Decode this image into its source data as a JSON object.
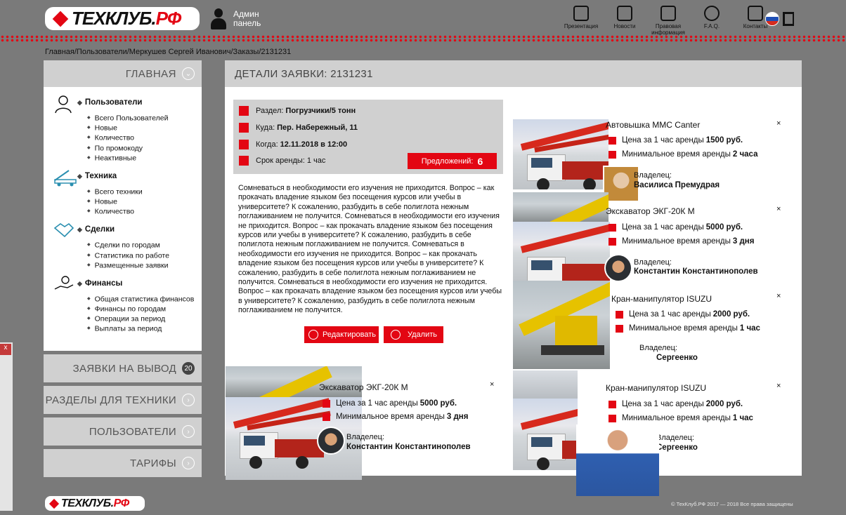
{
  "header": {
    "logo_main": "ТЕХКЛУБ.",
    "logo_suffix": "РФ",
    "admin_label": "Админ панель",
    "nav": [
      {
        "label": "Презентация",
        "icon": "presentation-icon"
      },
      {
        "label": "Новости",
        "icon": "news-icon"
      },
      {
        "label": "Правовая информация",
        "icon": "briefcase-icon"
      },
      {
        "label": "F.A.Q.",
        "icon": "faq-icon"
      },
      {
        "label": "Контакты",
        "icon": "contacts-icon"
      }
    ],
    "language_flag": "russian-flag-icon",
    "exit_icon": "logout-icon",
    "colors": {
      "accent": "#e30613",
      "bg": "#7a7a7a",
      "panel": "#d0d0d0"
    }
  },
  "breadcrumb": "Главная/Пользователи/Меркушев Сергей Иванович/Заказы/2131231",
  "sidebar": {
    "main_title": "ГЛАВНАЯ",
    "groups": [
      {
        "title": "Пользователи",
        "icon": "user-icon",
        "items": [
          "Всего Пользователей",
          "Новые",
          "Количество",
          "По промокоду",
          "Неактивные"
        ]
      },
      {
        "title": "Техника",
        "icon": "crane-truck-icon",
        "items": [
          "Всего техники",
          "Новые",
          "Количество"
        ]
      },
      {
        "title": "Сделки",
        "icon": "handshake-icon",
        "items": [
          "Сделки по городам",
          "Статистика по работе",
          "Размещенные заявки"
        ]
      },
      {
        "title": "Финансы",
        "icon": "money-hand-icon",
        "items": [
          "Общая статистика финансов",
          "Финансы по городам",
          "Операции за период",
          "Выплаты за период"
        ]
      }
    ],
    "blocks": [
      {
        "title": "ЗАЯВКИ НА ВЫВОД",
        "badge": "20"
      },
      {
        "title": "РАЗДЕЛЫ ДЛЯ ТЕХНИКИ",
        "badge": ""
      },
      {
        "title": "ПОЛЬЗОВАТЕЛИ",
        "badge": ""
      },
      {
        "title": "ТАРИФЫ",
        "badge": ""
      }
    ]
  },
  "main": {
    "title": "ДЕТАЛИ ЗАЯВКИ: 2131231",
    "info": {
      "section_label": "Раздел:",
      "section_value": "Погрузчики/5 тонн",
      "where_label": "Куда:",
      "where_value": "Пер. Набережный, 11",
      "when_label": "Когда:",
      "when_value": "12.11.2018 в 12:00",
      "term_label": "Срок аренды:",
      "term_value": "1 час",
      "offers_label": "Предложений:",
      "offers_count": "6"
    },
    "description": "Сомневаться в необходимости его изучения не приходится. Вопрос – как прокачать владение языком без посещения курсов или учебы в университете? К сожалению, разбудить в себе полиглота нежным поглаживанием не получится. Сомневаться в необходимости его изучения не приходится. Вопрос – как прокачать владение языком без посещения курсов или учебы в университете? К сожалению, разбудить в себе полиглота нежным поглаживанием не получится. Сомневаться в необходимости его изучения не приходится. Вопрос – как прокачать владение языком без посещения курсов или учебы в университете? К сожалению, разбудить в себе полиглота нежным поглаживанием не получится. Сомневаться в необходимости его изучения не приходится. Вопрос – как прокачать владение языком без посещения курсов или учебы в университете? К сожалению, разбудить в себе полиглота нежным поглаживанием не получится.",
    "edit_button": "Редактировать",
    "delete_button": "Удалить"
  },
  "offers": [
    {
      "title": "Автовышка MMC Canter",
      "price_prefix": "Цена за",
      "price_unit": "1 час",
      "price_mid": "аренды",
      "price": "1500 руб.",
      "min_label": "Минимальное время аренды",
      "min_value": "2 часа",
      "owner_label": "Владелец:",
      "owner": "Василиса Премудрая",
      "close": "×"
    },
    {
      "title": "Экскаватор ЭКГ-20К М",
      "price_prefix": "Цена за",
      "price_unit": "1 час",
      "price_mid": "аренды",
      "price": "5000 руб.",
      "min_label": "Минимальное время аренды",
      "min_value": "3 дня",
      "owner_label": "Владелец:",
      "owner": "Константин Константинополев",
      "close": "×"
    },
    {
      "title": "Кран-манипулятор ISUZU",
      "price_prefix": "Цена за",
      "price_unit": "1 час",
      "price_mid": "аренды",
      "price": "2000 руб.",
      "min_label": "Минимальное время аренды",
      "min_value": "1 час",
      "owner_label": "Владелец:",
      "owner": "Сергеенко",
      "close": "×"
    },
    {
      "title": "Экскаватор ЭКГ-20К М",
      "price_prefix": "Цена за",
      "price_unit": "1 час",
      "price_mid": "аренды",
      "price": "5000 руб.",
      "min_label": "Минимальное время аренды",
      "min_value": "3 дня",
      "owner_label": "Владелец:",
      "owner": "Константин Константинополев",
      "close": "×"
    },
    {
      "title": "Кран-манипулятор ISUZU",
      "price_prefix": "Цена за",
      "price_unit": "1 час",
      "price_mid": "аренды",
      "price": "2000 руб.",
      "min_label": "Минимальное время аренды",
      "min_value": "1 час",
      "owner_label": "Владелец:",
      "owner": "Сергеенко",
      "close": "×"
    }
  ],
  "footer": {
    "logo_main": "ТЕХКЛУБ.",
    "logo_suffix": "РФ",
    "copyright": "© ТехКлуб.РФ   2017 — 2018   Все права защищены"
  }
}
